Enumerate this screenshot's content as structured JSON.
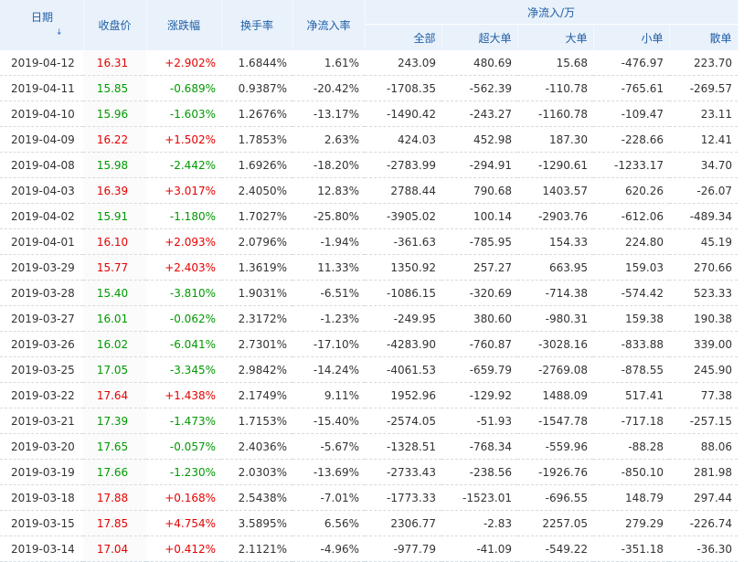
{
  "header": {
    "date": "日期",
    "sort_icon": "arrow-down-icon",
    "close": "收盘价",
    "change": "涨跌幅",
    "turnover": "换手率",
    "net_rate": "净流入率",
    "net_flow": "净流入/万",
    "all": "全部",
    "xlarge": "超大单",
    "large": "大单",
    "small": "小单",
    "retail": "散单"
  },
  "colors": {
    "up": "#e60000",
    "down": "#009900",
    "header_bg": "#e9f1fb",
    "header_text": "#1f5fa6"
  },
  "rows": [
    {
      "date": "2019-04-12",
      "close": "16.31",
      "change": "+2.902%",
      "turnover": "1.6844%",
      "rate": "1.61%",
      "all": "243.09",
      "xl": "480.69",
      "l": "15.68",
      "s": "-476.97",
      "r": "223.70",
      "dir": "up"
    },
    {
      "date": "2019-04-11",
      "close": "15.85",
      "change": "-0.689%",
      "turnover": "0.9387%",
      "rate": "-20.42%",
      "all": "-1708.35",
      "xl": "-562.39",
      "l": "-110.78",
      "s": "-765.61",
      "r": "-269.57",
      "dir": "down"
    },
    {
      "date": "2019-04-10",
      "close": "15.96",
      "change": "-1.603%",
      "turnover": "1.2676%",
      "rate": "-13.17%",
      "all": "-1490.42",
      "xl": "-243.27",
      "l": "-1160.78",
      "s": "-109.47",
      "r": "23.11",
      "dir": "down"
    },
    {
      "date": "2019-04-09",
      "close": "16.22",
      "change": "+1.502%",
      "turnover": "1.7853%",
      "rate": "2.63%",
      "all": "424.03",
      "xl": "452.98",
      "l": "187.30",
      "s": "-228.66",
      "r": "12.41",
      "dir": "up"
    },
    {
      "date": "2019-04-08",
      "close": "15.98",
      "change": "-2.442%",
      "turnover": "1.6926%",
      "rate": "-18.20%",
      "all": "-2783.99",
      "xl": "-294.91",
      "l": "-1290.61",
      "s": "-1233.17",
      "r": "34.70",
      "dir": "down"
    },
    {
      "date": "2019-04-03",
      "close": "16.39",
      "change": "+3.017%",
      "turnover": "2.4050%",
      "rate": "12.83%",
      "all": "2788.44",
      "xl": "790.68",
      "l": "1403.57",
      "s": "620.26",
      "r": "-26.07",
      "dir": "up"
    },
    {
      "date": "2019-04-02",
      "close": "15.91",
      "change": "-1.180%",
      "turnover": "1.7027%",
      "rate": "-25.80%",
      "all": "-3905.02",
      "xl": "100.14",
      "l": "-2903.76",
      "s": "-612.06",
      "r": "-489.34",
      "dir": "down"
    },
    {
      "date": "2019-04-01",
      "close": "16.10",
      "change": "+2.093%",
      "turnover": "2.0796%",
      "rate": "-1.94%",
      "all": "-361.63",
      "xl": "-785.95",
      "l": "154.33",
      "s": "224.80",
      "r": "45.19",
      "dir": "up"
    },
    {
      "date": "2019-03-29",
      "close": "15.77",
      "change": "+2.403%",
      "turnover": "1.3619%",
      "rate": "11.33%",
      "all": "1350.92",
      "xl": "257.27",
      "l": "663.95",
      "s": "159.03",
      "r": "270.66",
      "dir": "up"
    },
    {
      "date": "2019-03-28",
      "close": "15.40",
      "change": "-3.810%",
      "turnover": "1.9031%",
      "rate": "-6.51%",
      "all": "-1086.15",
      "xl": "-320.69",
      "l": "-714.38",
      "s": "-574.42",
      "r": "523.33",
      "dir": "down"
    },
    {
      "date": "2019-03-27",
      "close": "16.01",
      "change": "-0.062%",
      "turnover": "2.3172%",
      "rate": "-1.23%",
      "all": "-249.95",
      "xl": "380.60",
      "l": "-980.31",
      "s": "159.38",
      "r": "190.38",
      "dir": "down"
    },
    {
      "date": "2019-03-26",
      "close": "16.02",
      "change": "-6.041%",
      "turnover": "2.7301%",
      "rate": "-17.10%",
      "all": "-4283.90",
      "xl": "-760.87",
      "l": "-3028.16",
      "s": "-833.88",
      "r": "339.00",
      "dir": "down"
    },
    {
      "date": "2019-03-25",
      "close": "17.05",
      "change": "-3.345%",
      "turnover": "2.9842%",
      "rate": "-14.24%",
      "all": "-4061.53",
      "xl": "-659.79",
      "l": "-2769.08",
      "s": "-878.55",
      "r": "245.90",
      "dir": "down"
    },
    {
      "date": "2019-03-22",
      "close": "17.64",
      "change": "+1.438%",
      "turnover": "2.1749%",
      "rate": "9.11%",
      "all": "1952.96",
      "xl": "-129.92",
      "l": "1488.09",
      "s": "517.41",
      "r": "77.38",
      "dir": "up"
    },
    {
      "date": "2019-03-21",
      "close": "17.39",
      "change": "-1.473%",
      "turnover": "1.7153%",
      "rate": "-15.40%",
      "all": "-2574.05",
      "xl": "-51.93",
      "l": "-1547.78",
      "s": "-717.18",
      "r": "-257.15",
      "dir": "down"
    },
    {
      "date": "2019-03-20",
      "close": "17.65",
      "change": "-0.057%",
      "turnover": "2.4036%",
      "rate": "-5.67%",
      "all": "-1328.51",
      "xl": "-768.34",
      "l": "-559.96",
      "s": "-88.28",
      "r": "88.06",
      "dir": "down"
    },
    {
      "date": "2019-03-19",
      "close": "17.66",
      "change": "-1.230%",
      "turnover": "2.0303%",
      "rate": "-13.69%",
      "all": "-2733.43",
      "xl": "-238.56",
      "l": "-1926.76",
      "s": "-850.10",
      "r": "281.98",
      "dir": "down"
    },
    {
      "date": "2019-03-18",
      "close": "17.88",
      "change": "+0.168%",
      "turnover": "2.5438%",
      "rate": "-7.01%",
      "all": "-1773.33",
      "xl": "-1523.01",
      "l": "-696.55",
      "s": "148.79",
      "r": "297.44",
      "dir": "up"
    },
    {
      "date": "2019-03-15",
      "close": "17.85",
      "change": "+4.754%",
      "turnover": "3.5895%",
      "rate": "6.56%",
      "all": "2306.77",
      "xl": "-2.83",
      "l": "2257.05",
      "s": "279.29",
      "r": "-226.74",
      "dir": "up"
    },
    {
      "date": "2019-03-14",
      "close": "17.04",
      "change": "+0.412%",
      "turnover": "2.1121%",
      "rate": "-4.96%",
      "all": "-977.79",
      "xl": "-41.09",
      "l": "-549.22",
      "s": "-351.18",
      "r": "-36.30",
      "dir": "up"
    }
  ]
}
